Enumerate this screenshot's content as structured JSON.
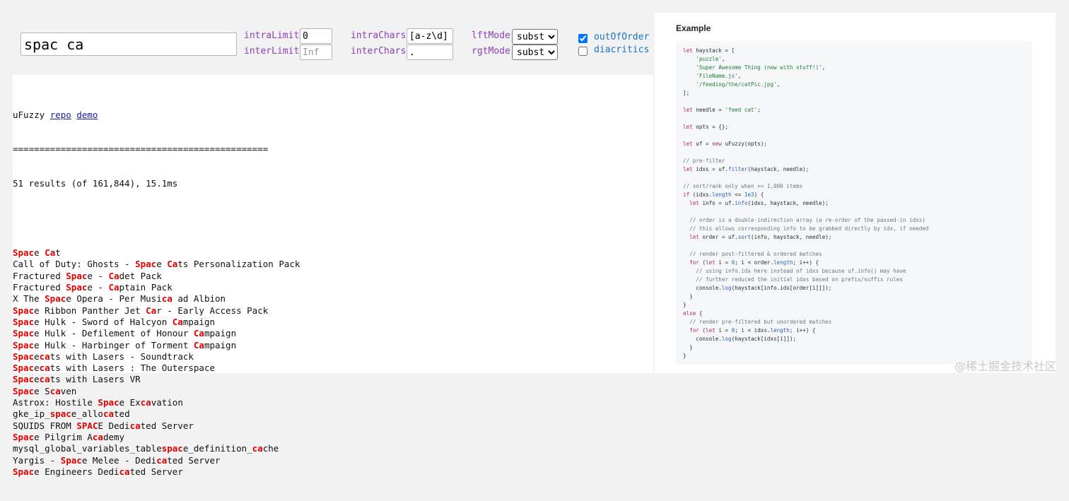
{
  "search": {
    "value": "spac ca"
  },
  "options": {
    "intraLimit": {
      "label": "intraLimit",
      "value": "0",
      "placeholder": ""
    },
    "interLimit": {
      "label": "interLimit",
      "value": "",
      "placeholder": "Inf"
    },
    "intraChars": {
      "label": "intraChars",
      "value": "[a-z\\d]"
    },
    "interChars": {
      "label": "interChars",
      "value": "."
    },
    "lftMode": {
      "label": "lftMode",
      "value": "substr"
    },
    "rgtMode": {
      "label": "rgtMode",
      "value": "substr"
    },
    "outOfOrder": {
      "label": "outOfOrder",
      "checked": true
    },
    "diacritics": {
      "label": "diacritics",
      "checked": false
    }
  },
  "header": {
    "title": "uFuzzy",
    "repo_link": "repo",
    "demo_link": "demo",
    "separator": "================================================",
    "summary": "51 results (of 161,844), 15.1ms"
  },
  "results": [
    [
      {
        "h": "Spac"
      },
      {
        "t": "e "
      },
      {
        "h": "Ca"
      },
      {
        "t": "t"
      }
    ],
    [
      {
        "t": "Call of Duty: Ghosts - "
      },
      {
        "h": "Spac"
      },
      {
        "t": "e "
      },
      {
        "h": "Ca"
      },
      {
        "t": "ts Personalization Pack"
      }
    ],
    [
      {
        "t": "Fractured "
      },
      {
        "h": "Spac"
      },
      {
        "t": "e - "
      },
      {
        "h": "Ca"
      },
      {
        "t": "det Pack"
      }
    ],
    [
      {
        "t": "Fractured "
      },
      {
        "h": "Spac"
      },
      {
        "t": "e - "
      },
      {
        "h": "Ca"
      },
      {
        "t": "ptain Pack"
      }
    ],
    [
      {
        "t": "X The "
      },
      {
        "h": "Spac"
      },
      {
        "t": "e Opera - Per Musi"
      },
      {
        "h": "ca"
      },
      {
        "t": " ad Albion"
      }
    ],
    [
      {
        "h": "Spac"
      },
      {
        "t": "e Ribbon Panther Jet "
      },
      {
        "h": "Ca"
      },
      {
        "t": "r - Early Access Pack"
      }
    ],
    [
      {
        "h": "Spac"
      },
      {
        "t": "e Hulk - Sword of Halcyon "
      },
      {
        "h": "Ca"
      },
      {
        "t": "mpaign"
      }
    ],
    [
      {
        "h": "Spac"
      },
      {
        "t": "e Hulk - Defilement of Honour "
      },
      {
        "h": "Ca"
      },
      {
        "t": "mpaign"
      }
    ],
    [
      {
        "h": "Spac"
      },
      {
        "t": "e Hulk - Harbinger of Torment "
      },
      {
        "h": "Ca"
      },
      {
        "t": "mpaign"
      }
    ],
    [
      {
        "h": "Spac"
      },
      {
        "t": "e"
      },
      {
        "h": "ca"
      },
      {
        "t": "ts with Lasers - Soundtrack"
      }
    ],
    [
      {
        "h": "Spac"
      },
      {
        "t": "e"
      },
      {
        "h": "ca"
      },
      {
        "t": "ts with Lasers : The Outerspace"
      }
    ],
    [
      {
        "h": "Spac"
      },
      {
        "t": "e"
      },
      {
        "h": "ca"
      },
      {
        "t": "ts with Lasers VR"
      }
    ],
    [
      {
        "h": "Spac"
      },
      {
        "t": "e S"
      },
      {
        "h": "ca"
      },
      {
        "t": "ven"
      }
    ],
    [
      {
        "t": "Astrox: Hostile "
      },
      {
        "h": "Spac"
      },
      {
        "t": "e Ex"
      },
      {
        "h": "ca"
      },
      {
        "t": "vation"
      }
    ],
    [
      {
        "t": "gke_ip_"
      },
      {
        "h": "spac"
      },
      {
        "t": "e_allo"
      },
      {
        "h": "ca"
      },
      {
        "t": "ted"
      }
    ],
    [
      {
        "t": "SQUIDS FROM "
      },
      {
        "h": "SPAC"
      },
      {
        "t": "E Dedi"
      },
      {
        "h": "ca"
      },
      {
        "t": "ted Server"
      }
    ],
    [
      {
        "h": "Spac"
      },
      {
        "t": "e Pilgrim A"
      },
      {
        "h": "ca"
      },
      {
        "t": "demy"
      }
    ],
    [
      {
        "t": "mysql_global_variables_table"
      },
      {
        "h": "spac"
      },
      {
        "t": "e_definition_"
      },
      {
        "h": "ca"
      },
      {
        "t": "che"
      }
    ],
    [
      {
        "t": "Yargis - "
      },
      {
        "h": "Spac"
      },
      {
        "t": "e Melee - Dedi"
      },
      {
        "h": "ca"
      },
      {
        "t": "ted Server"
      }
    ],
    [
      {
        "h": "Spac"
      },
      {
        "t": "e Engineers Dedi"
      },
      {
        "h": "ca"
      },
      {
        "t": "ted Server"
      }
    ]
  ],
  "example": {
    "title": "Example",
    "code": [
      [
        {
          "k": "let"
        },
        {
          "t": " haystack = ["
        }
      ],
      [
        {
          "t": "    "
        },
        {
          "s": "'puzzle'"
        },
        {
          "t": ","
        }
      ],
      [
        {
          "t": "    "
        },
        {
          "s": "'Super Awesome Thing (now with stuff!)'"
        },
        {
          "t": ","
        }
      ],
      [
        {
          "t": "    "
        },
        {
          "s": "'FileName.js'"
        },
        {
          "t": ","
        }
      ],
      [
        {
          "t": "    "
        },
        {
          "s": "'/feeding/the/catPic.jpg'"
        },
        {
          "t": ","
        }
      ],
      [
        {
          "t": "];"
        }
      ],
      [],
      [
        {
          "k": "let"
        },
        {
          "t": " needle = "
        },
        {
          "s": "'feed cat'"
        },
        {
          "t": ";"
        }
      ],
      [],
      [
        {
          "k": "let"
        },
        {
          "t": " opts = {};"
        }
      ],
      [],
      [
        {
          "k": "let"
        },
        {
          "t": " uf = "
        },
        {
          "k": "new"
        },
        {
          "t": " uFuzzy(opts);"
        }
      ],
      [],
      [
        {
          "c": "// pre-filter"
        }
      ],
      [
        {
          "k": "let"
        },
        {
          "t": " idxs = uf."
        },
        {
          "f": "filter"
        },
        {
          "t": "(haystack, needle);"
        }
      ],
      [],
      [
        {
          "c": "// sort/rank only when <= 1,000 items"
        }
      ],
      [
        {
          "k": "if"
        },
        {
          "t": " (idxs."
        },
        {
          "f": "length"
        },
        {
          "t": " <= "
        },
        {
          "n": "1e3"
        },
        {
          "t": ") {"
        }
      ],
      [
        {
          "t": "  "
        },
        {
          "k": "let"
        },
        {
          "t": " info = uf."
        },
        {
          "f": "info"
        },
        {
          "t": "(idxs, haystack, needle);"
        }
      ],
      [],
      [
        {
          "t": "  "
        },
        {
          "c": "// order is a double-indirection array (a re-order of the passed-in idxs)"
        }
      ],
      [
        {
          "t": "  "
        },
        {
          "c": "// this allows corresponding info to be grabbed directly by idx, if needed"
        }
      ],
      [
        {
          "t": "  "
        },
        {
          "k": "let"
        },
        {
          "t": " order = uf."
        },
        {
          "f": "sort"
        },
        {
          "t": "(info, haystack, needle);"
        }
      ],
      [],
      [
        {
          "t": "  "
        },
        {
          "c": "// render post-filtered & ordered matches"
        }
      ],
      [
        {
          "t": "  "
        },
        {
          "k": "for"
        },
        {
          "t": " ("
        },
        {
          "k": "let"
        },
        {
          "t": " i = "
        },
        {
          "n": "0"
        },
        {
          "t": "; i < order."
        },
        {
          "f": "length"
        },
        {
          "t": "; i++) {"
        }
      ],
      [
        {
          "t": "    "
        },
        {
          "c": "// using info.idx here instead of idxs because uf.info() may have"
        }
      ],
      [
        {
          "t": "    "
        },
        {
          "c": "// further reduced the initial idxs based on prefix/suffix rules"
        }
      ],
      [
        {
          "t": "    console."
        },
        {
          "f": "log"
        },
        {
          "t": "(haystack[info.idx[order[i]]]);"
        }
      ],
      [
        {
          "t": "  }"
        }
      ],
      [
        {
          "t": "}"
        }
      ],
      [
        {
          "k": "else"
        },
        {
          "t": " {"
        }
      ],
      [
        {
          "t": "  "
        },
        {
          "c": "// render pre-filtered but unordered matches"
        }
      ],
      [
        {
          "t": "  "
        },
        {
          "k": "for"
        },
        {
          "t": " ("
        },
        {
          "k": "let"
        },
        {
          "t": " i = "
        },
        {
          "n": "0"
        },
        {
          "t": "; i < idxs."
        },
        {
          "f": "length"
        },
        {
          "t": "; i++) {"
        }
      ],
      [
        {
          "t": "    console."
        },
        {
          "f": "log"
        },
        {
          "t": "(haystack[idxs[i]]);"
        }
      ],
      [
        {
          "t": "  }"
        }
      ],
      [
        {
          "t": "}"
        }
      ]
    ]
  },
  "watermark": "@稀土掘金技术社区"
}
